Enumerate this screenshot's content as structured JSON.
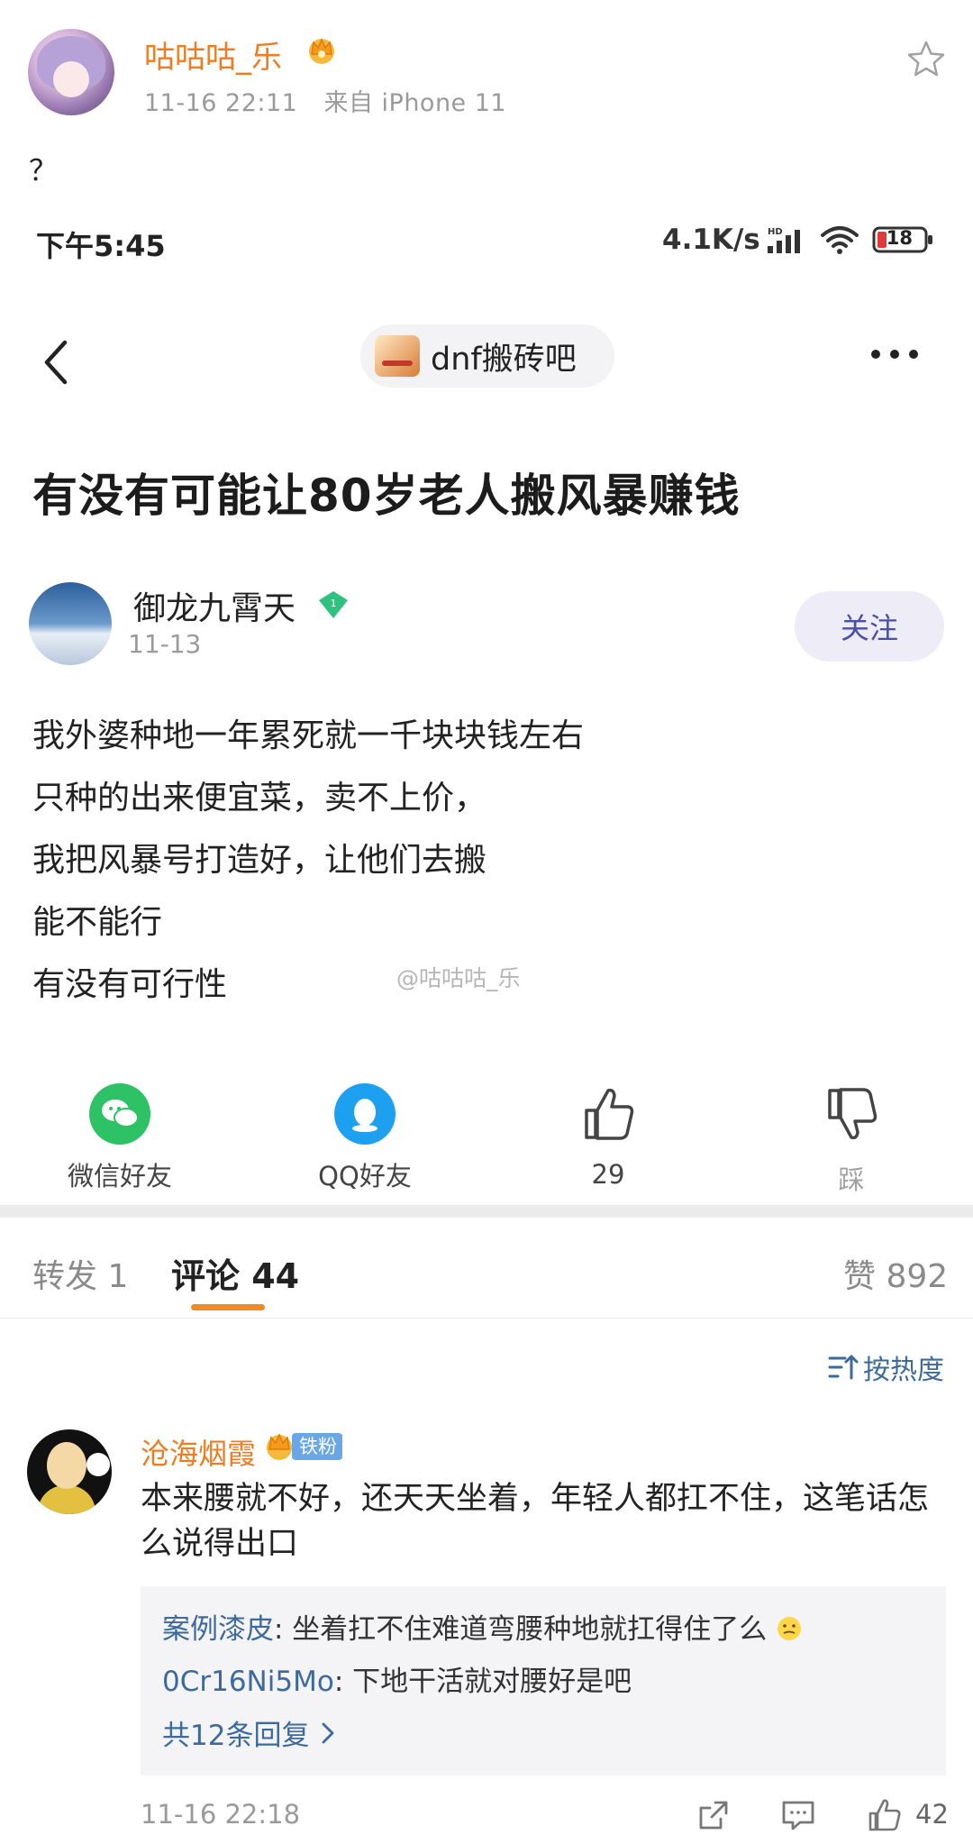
{
  "post": {
    "username": "咕咕咕_乐",
    "time": "11-16 22:11",
    "source": "来自 iPhone 11",
    "text": "？"
  },
  "screenshot": {
    "status_time": "下午5:45",
    "net_speed": "4.1K/s",
    "battery": "18",
    "forum_name": "dnf搬砖吧",
    "title": "有没有可能让80岁老人搬风暴赚钱",
    "author": {
      "name": "御龙九霄天",
      "level": "1",
      "date": "11-13",
      "follow_label": "关注"
    },
    "body_lines": [
      "我外婆种地一年累死就一千块块钱左右",
      "只种的出来便宜菜，卖不上价，",
      "我把风暴号打造好，让他们去搬",
      "能不能行",
      "有没有可行性"
    ],
    "share": {
      "wechat": "微信好友",
      "qq": "QQ好友",
      "like_count": "29",
      "dislike": "踩"
    },
    "watermark": "@咕咕咕_乐"
  },
  "tabs": {
    "repost": "转发 1",
    "comments": "评论 44",
    "likes": "赞 892"
  },
  "sort": {
    "label": "按热度"
  },
  "comment": {
    "name": "沧海烟霞",
    "fan_badge": "铁粉",
    "text": "本来腰就不好，还天天坐着，年轻人都扛不住，这笔话怎么说得出口",
    "replies": [
      {
        "user": "案例漆皮",
        "text": ": 坐着扛不住难道弯腰种地就扛得住了么"
      },
      {
        "user": "0Cr16Ni5Mo",
        "text": ": 下地干活就对腰好是吧"
      }
    ],
    "more_replies": "共12条回复",
    "time": "11-16 22:18",
    "likes": "42"
  },
  "colors": {
    "orange_name": "#f07c1f",
    "link_blue": "#3d6a9e",
    "follow_purple": "#4b4fa8",
    "wechat_green": "#2dc265",
    "qq_blue": "#1ea0f1",
    "tab_underline": "#f08a24"
  }
}
